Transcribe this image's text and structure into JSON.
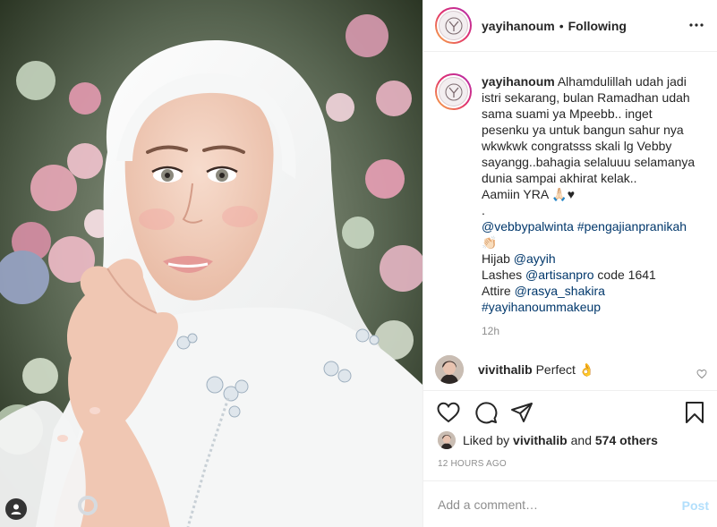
{
  "post": {
    "username": "yayihanoum",
    "separator": "•",
    "follow_status": "Following",
    "caption": {
      "username": "yayihanoum",
      "lines": [
        "Alhamdulillah udah jadi",
        "istri sekarang, bulan Ramadhan udah",
        "sama suami ya Mpeebb.. inget",
        "pesenku ya untuk bangun sahur nya",
        "wkwkwk congratsss skali lg Vebby",
        "sayangg..bahagia selaluuu selamanya",
        "dunia sampai akhirat kelak..",
        "Aamiin YRA 🙏🏻♥",
        "."
      ],
      "mention_line": {
        "mention": "@vebbypalwinta",
        "hashtag": "#pengajianpranikah"
      },
      "emoji_line": "👏🏻",
      "credits": [
        {
          "label": "Hijab ",
          "link": "@ayyih",
          "suffix": ""
        },
        {
          "label": "Lashes ",
          "link": "@artisanpro",
          "suffix": " code 1641"
        },
        {
          "label": "Attire ",
          "link": "@rasya_shakira",
          "suffix": ""
        }
      ],
      "final_hashtag": "#yayihanoummakeup",
      "time": "12h"
    },
    "comment": {
      "username": "vivithalib",
      "text": "Perfect 👌"
    },
    "likes": {
      "prefix": "Liked by ",
      "user": "vivithalib",
      "middle": " and ",
      "others": "574 others"
    },
    "timestamp": "12 HOURS AGO",
    "add_comment": {
      "placeholder": "Add a comment…",
      "post_label": "Post"
    }
  },
  "icons": {
    "more": "more-horizontal-icon",
    "like": "heart-icon",
    "comment": "comment-bubble-icon",
    "share": "paper-plane-icon",
    "save": "bookmark-icon",
    "tag": "person-tag-icon"
  },
  "colors": {
    "link": "#00376b",
    "post_button": "#b2dffc",
    "muted": "#8e8e8e",
    "text": "#262626"
  }
}
